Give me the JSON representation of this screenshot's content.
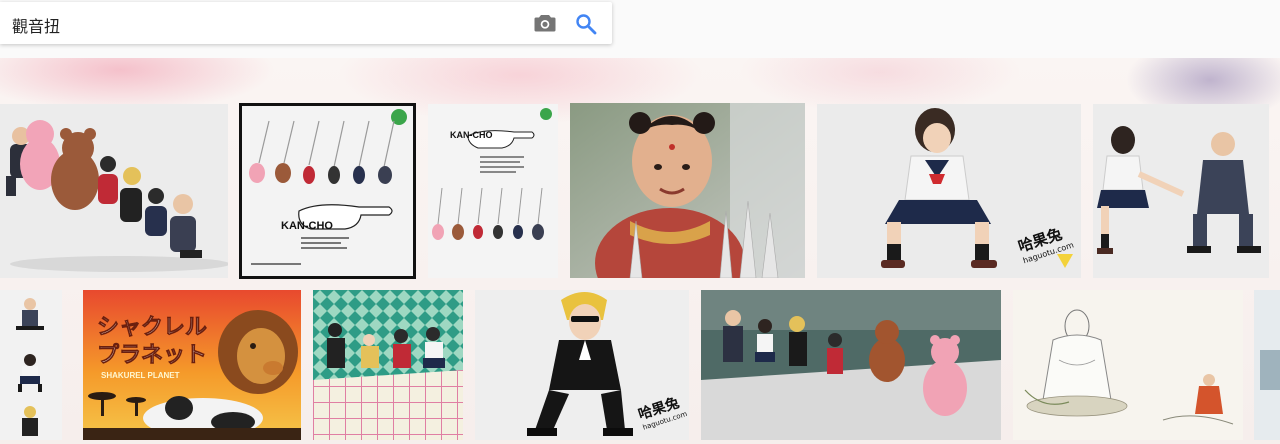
{
  "search": {
    "query": "觀音扭"
  },
  "icons": {
    "camera": "camera-icon",
    "search": "search-icon"
  },
  "colors": {
    "search_blue": "#4285f4",
    "icon_grey": "#757575"
  },
  "results": {
    "row1": [
      {
        "id": "figures-lineup"
      },
      {
        "id": "kancho-poster",
        "brand": "KAN-CHO"
      },
      {
        "id": "kancho-keychains",
        "brand": "KAN-CHO"
      },
      {
        "id": "child-actor"
      },
      {
        "id": "schoolgirl-figure",
        "watermark_cn": "哈果兔",
        "watermark_url": "haguotu.com"
      },
      {
        "id": "schoolgirl-and-salaryman"
      }
    ],
    "row2": [
      {
        "id": "figure-strip"
      },
      {
        "id": "shakurel-planet",
        "title_jp_1": "シャクレル",
        "title_jp_2": "プラネット",
        "subtitle_en": "SHAKUREL PLANET"
      },
      {
        "id": "figures-on-grid"
      },
      {
        "id": "sunglasses-figure",
        "watermark_cn": "哈果兔",
        "watermark_url": "haguotu.com"
      },
      {
        "id": "figures-table"
      },
      {
        "id": "guanyin-painting"
      }
    ]
  }
}
